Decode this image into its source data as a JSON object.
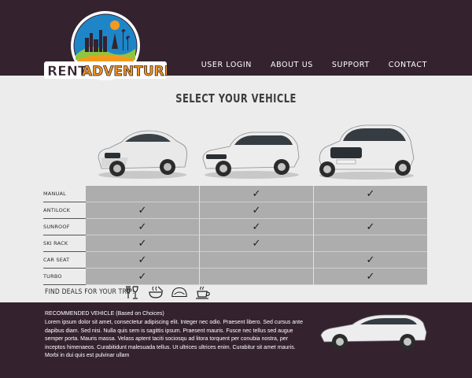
{
  "logo": {
    "word1": "RENT",
    "word2": "ADVENTURE"
  },
  "nav": [
    "USER LOGIN",
    "ABOUT US",
    "SUPPORT",
    "CONTACT"
  ],
  "title": "SELECT YOUR VEHICLE",
  "features": [
    {
      "label": "MANUAL",
      "checks": [
        "",
        "✓",
        "✓"
      ]
    },
    {
      "label": "ANTILOCK BRAKES",
      "checks": [
        "✓",
        "✓",
        ""
      ]
    },
    {
      "label": "SUNROOF",
      "checks": [
        "✓",
        "✓",
        "✓"
      ]
    },
    {
      "label": "SKI RACK",
      "checks": [
        "✓",
        "✓",
        ""
      ]
    },
    {
      "label": "CAR SEAT",
      "checks": [
        "✓",
        "",
        "✓"
      ]
    },
    {
      "label": "TURBO",
      "checks": [
        "✓",
        "",
        "✓"
      ]
    }
  ],
  "deals": {
    "label": "FIND DEALS FOR YOUR TRIP!",
    "icons": [
      "restaurant-icon",
      "soup-bowl-icon",
      "taco-icon",
      "coffee-cup-icon"
    ]
  },
  "recommendation": {
    "title": "RECOMMENDED VEHICLE (Based on Choices)",
    "body": "Lorem ipsum dolor sit amet, consectetur adipiscing elit. Integer nec odio. Praesent libero. Sed cursus ante dapibus diam. Sed nisi. Nulla quis sem is sagittis ipsum. Praesent mauris. Fusce nec tellus sed augue semper porta. Mauris massa. Velass aptent taciti sociosqu ad litora torquent per conubia nostra, per inceptos himenaeos. Curabitidunt malesuada tellus. Ut ultrices ultrices enim. Curabitur sit amet mauris. Morbi in dui quis est pulvinar ullam"
  },
  "colors": {
    "header": "#34222f",
    "body": "#ececed",
    "cell": "#adadad",
    "logo_orange": "#f39a1e",
    "logo_blue": "#1e86c8"
  }
}
